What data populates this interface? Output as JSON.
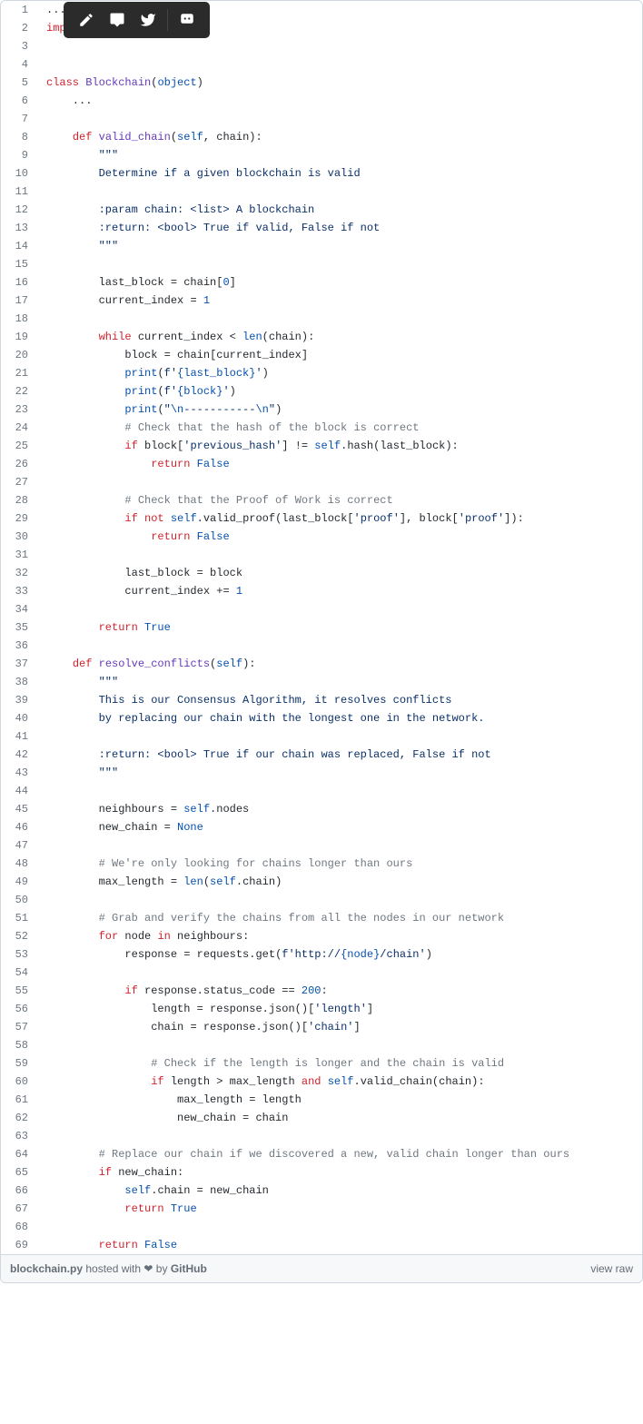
{
  "toolbar": {
    "edit": "edit-icon",
    "comment": "comment-icon",
    "twitter": "twitter-icon",
    "feedback": "feedback-icon"
  },
  "code": {
    "lines": [
      {
        "n": 1,
        "html": "..."
      },
      {
        "n": 2,
        "html": "<span class='k'>import</span> <span class='n'>requests</span>"
      },
      {
        "n": 3,
        "html": ""
      },
      {
        "n": 4,
        "html": ""
      },
      {
        "n": 5,
        "html": "<span class='k'>class</span> <span class='f'>Blockchain</span>(<span class='b'>object</span>)"
      },
      {
        "n": 6,
        "html": "    ..."
      },
      {
        "n": 7,
        "html": ""
      },
      {
        "n": 8,
        "html": "    <span class='k'>def</span> <span class='f'>valid_chain</span>(<span class='b'>self</span>, <span class='n'>chain</span>):"
      },
      {
        "n": 9,
        "html": "        <span class='d'>\"\"\"</span>"
      },
      {
        "n": 10,
        "html": "<span class='d'>        Determine if a given blockchain is valid</span>"
      },
      {
        "n": 11,
        "html": ""
      },
      {
        "n": 12,
        "html": "<span class='d'>        :param chain: &lt;list&gt; A blockchain</span>"
      },
      {
        "n": 13,
        "html": "<span class='d'>        :return: &lt;bool&gt; True if valid, False if not</span>"
      },
      {
        "n": 14,
        "html": "<span class='d'>        \"\"\"</span>"
      },
      {
        "n": 15,
        "html": ""
      },
      {
        "n": 16,
        "html": "        <span class='n'>last_block</span> <span class='o'>=</span> <span class='n'>chain</span>[<span class='num'>0</span>]"
      },
      {
        "n": 17,
        "html": "        <span class='n'>current_index</span> <span class='o'>=</span> <span class='num'>1</span>"
      },
      {
        "n": 18,
        "html": ""
      },
      {
        "n": 19,
        "html": "        <span class='k'>while</span> <span class='n'>current_index</span> <span class='o'>&lt;</span> <span class='b'>len</span>(<span class='n'>chain</span>):"
      },
      {
        "n": 20,
        "html": "            <span class='n'>block</span> <span class='o'>=</span> <span class='n'>chain</span>[<span class='n'>current_index</span>]"
      },
      {
        "n": 21,
        "html": "            <span class='b'>print</span>(<span class='s'>f'</span><span class='num'>{last_block}</span><span class='s'>'</span>)"
      },
      {
        "n": 22,
        "html": "            <span class='b'>print</span>(<span class='s'>f'</span><span class='num'>{block}</span><span class='s'>'</span>)"
      },
      {
        "n": 23,
        "html": "            <span class='b'>print</span>(<span class='s'>\"</span><span class='num'>\\n</span><span class='s'>-----------</span><span class='num'>\\n</span><span class='s'>\"</span>)"
      },
      {
        "n": 24,
        "html": "            <span class='c'># Check that the hash of the block is correct</span>"
      },
      {
        "n": 25,
        "html": "            <span class='k'>if</span> <span class='n'>block</span>[<span class='s'>'previous_hash'</span>] <span class='o'>!=</span> <span class='b'>self</span>.<span class='n'>hash</span>(<span class='n'>last_block</span>):"
      },
      {
        "n": 26,
        "html": "                <span class='k'>return</span> <span class='b'>False</span>"
      },
      {
        "n": 27,
        "html": ""
      },
      {
        "n": 28,
        "html": "            <span class='c'># Check that the Proof of Work is correct</span>"
      },
      {
        "n": 29,
        "html": "            <span class='k'>if</span> <span class='k'>not</span> <span class='b'>self</span>.<span class='n'>valid_proof</span>(<span class='n'>last_block</span>[<span class='s'>'proof'</span>], <span class='n'>block</span>[<span class='s'>'proof'</span>]):"
      },
      {
        "n": 30,
        "html": "                <span class='k'>return</span> <span class='b'>False</span>"
      },
      {
        "n": 31,
        "html": ""
      },
      {
        "n": 32,
        "html": "            <span class='n'>last_block</span> <span class='o'>=</span> <span class='n'>block</span>"
      },
      {
        "n": 33,
        "html": "            <span class='n'>current_index</span> <span class='o'>+=</span> <span class='num'>1</span>"
      },
      {
        "n": 34,
        "html": ""
      },
      {
        "n": 35,
        "html": "        <span class='k'>return</span> <span class='b'>True</span>"
      },
      {
        "n": 36,
        "html": ""
      },
      {
        "n": 37,
        "html": "    <span class='k'>def</span> <span class='f'>resolve_conflicts</span>(<span class='b'>self</span>):"
      },
      {
        "n": 38,
        "html": "        <span class='d'>\"\"\"</span>"
      },
      {
        "n": 39,
        "html": "<span class='d'>        This is our Consensus Algorithm, it resolves conflicts</span>"
      },
      {
        "n": 40,
        "html": "<span class='d'>        by replacing our chain with the longest one in the network.</span>"
      },
      {
        "n": 41,
        "html": ""
      },
      {
        "n": 42,
        "html": "<span class='d'>        :return: &lt;bool&gt; True if our chain was replaced, False if not</span>"
      },
      {
        "n": 43,
        "html": "<span class='d'>        \"\"\"</span>"
      },
      {
        "n": 44,
        "html": ""
      },
      {
        "n": 45,
        "html": "        <span class='n'>neighbours</span> <span class='o'>=</span> <span class='b'>self</span>.<span class='n'>nodes</span>"
      },
      {
        "n": 46,
        "html": "        <span class='n'>new_chain</span> <span class='o'>=</span> <span class='b'>None</span>"
      },
      {
        "n": 47,
        "html": ""
      },
      {
        "n": 48,
        "html": "        <span class='c'># We're only looking for chains longer than ours</span>"
      },
      {
        "n": 49,
        "html": "        <span class='n'>max_length</span> <span class='o'>=</span> <span class='b'>len</span>(<span class='b'>self</span>.<span class='n'>chain</span>)"
      },
      {
        "n": 50,
        "html": ""
      },
      {
        "n": 51,
        "html": "        <span class='c'># Grab and verify the chains from all the nodes in our network</span>"
      },
      {
        "n": 52,
        "html": "        <span class='k'>for</span> <span class='n'>node</span> <span class='k'>in</span> <span class='n'>neighbours</span>:"
      },
      {
        "n": 53,
        "html": "            <span class='n'>response</span> <span class='o'>=</span> <span class='n'>requests</span>.<span class='n'>get</span>(<span class='s'>f'http://</span><span class='num'>{node}</span><span class='s'>/chain'</span>)"
      },
      {
        "n": 54,
        "html": ""
      },
      {
        "n": 55,
        "html": "            <span class='k'>if</span> <span class='n'>response</span>.<span class='n'>status_code</span> <span class='o'>==</span> <span class='num'>200</span>:"
      },
      {
        "n": 56,
        "html": "                <span class='n'>length</span> <span class='o'>=</span> <span class='n'>response</span>.<span class='n'>json</span>()[<span class='s'>'length'</span>]"
      },
      {
        "n": 57,
        "html": "                <span class='n'>chain</span> <span class='o'>=</span> <span class='n'>response</span>.<span class='n'>json</span>()[<span class='s'>'chain'</span>]"
      },
      {
        "n": 58,
        "html": ""
      },
      {
        "n": 59,
        "html": "                <span class='c'># Check if the length is longer and the chain is valid</span>"
      },
      {
        "n": 60,
        "html": "                <span class='k'>if</span> <span class='n'>length</span> <span class='o'>&gt;</span> <span class='n'>max_length</span> <span class='k'>and</span> <span class='b'>self</span>.<span class='n'>valid_chain</span>(<span class='n'>chain</span>):"
      },
      {
        "n": 61,
        "html": "                    <span class='n'>max_length</span> <span class='o'>=</span> <span class='n'>length</span>"
      },
      {
        "n": 62,
        "html": "                    <span class='n'>new_chain</span> <span class='o'>=</span> <span class='n'>chain</span>"
      },
      {
        "n": 63,
        "html": ""
      },
      {
        "n": 64,
        "html": "        <span class='c'># Replace our chain if we discovered a new, valid chain longer than ours</span>"
      },
      {
        "n": 65,
        "html": "        <span class='k'>if</span> <span class='n'>new_chain</span>:"
      },
      {
        "n": 66,
        "html": "            <span class='b'>self</span>.<span class='n'>chain</span> <span class='o'>=</span> <span class='n'>new_chain</span>"
      },
      {
        "n": 67,
        "html": "            <span class='k'>return</span> <span class='b'>True</span>"
      },
      {
        "n": 68,
        "html": ""
      },
      {
        "n": 69,
        "html": "        <span class='k'>return</span> <span class='b'>False</span>"
      }
    ]
  },
  "footer": {
    "filename": "blockchain.py",
    "hosted": " hosted with ",
    "heart": "❤",
    "by": " by ",
    "github": "GitHub",
    "viewraw": "view raw"
  }
}
